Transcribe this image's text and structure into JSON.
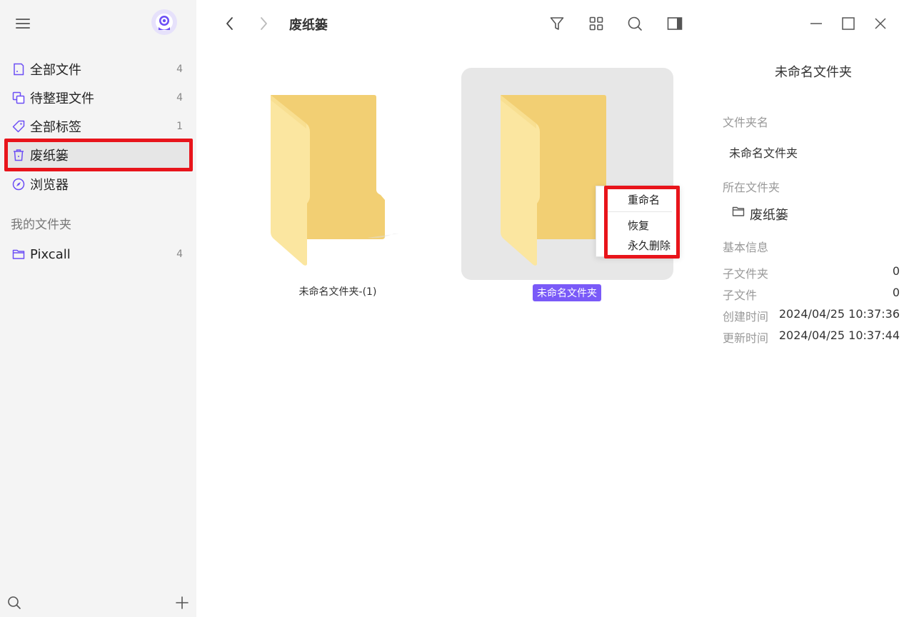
{
  "window": {
    "title": "废纸篓",
    "controls": [
      "minimize",
      "maximize",
      "close"
    ]
  },
  "sidebar": {
    "items": [
      {
        "label": "全部文件",
        "count": "4",
        "icon": "note-icon"
      },
      {
        "label": "待整理文件",
        "count": "4",
        "icon": "stack-icon"
      },
      {
        "label": "全部标签",
        "count": "1",
        "icon": "tag-icon"
      },
      {
        "label": "废纸篓",
        "count": "",
        "icon": "trash-icon",
        "active": true
      },
      {
        "label": "浏览器",
        "count": "",
        "icon": "compass-icon"
      }
    ],
    "section_title": "我的文件夹",
    "folders": [
      {
        "label": "Pixcall",
        "count": "4",
        "icon": "folder-icon"
      }
    ]
  },
  "main": {
    "folders": [
      {
        "name": "未命名文件夹-(1)",
        "selected": false
      },
      {
        "name": "未命名文件夹",
        "selected": true
      }
    ]
  },
  "context_menu": {
    "items": [
      "重命名",
      "恢复",
      "永久删除"
    ]
  },
  "info_panel": {
    "title": "未命名文件夹",
    "name_label": "文件夹名",
    "name_value": "未命名文件夹",
    "location_label": "所在文件夹",
    "location_value": "废纸篓",
    "basic_label": "基本信息",
    "rows": [
      {
        "label": "子文件夹",
        "value": "0"
      },
      {
        "label": "子文件",
        "value": "0"
      },
      {
        "label": "创建时间",
        "value": "2024/04/25 10:37:36"
      },
      {
        "label": "更新时间",
        "value": "2024/04/25 10:37:44"
      }
    ]
  },
  "colors": {
    "accent": "#7a5af8",
    "highlight_border": "#e8141b",
    "folder_light": "#fbe6a0",
    "folder_dark": "#f2cf73"
  }
}
